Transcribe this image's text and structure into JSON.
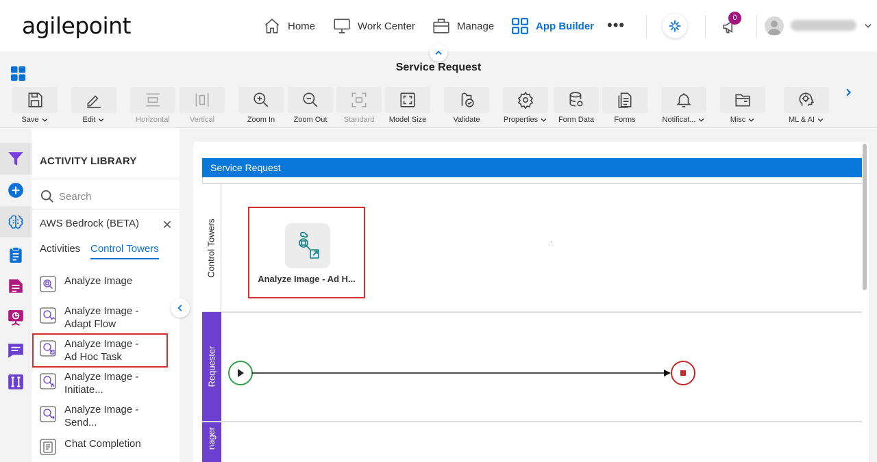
{
  "brand": {
    "logo_text": "agilepoint"
  },
  "nav": {
    "items": [
      {
        "label": "Home",
        "icon": "home-icon"
      },
      {
        "label": "Work Center",
        "icon": "monitor-icon"
      },
      {
        "label": "Manage",
        "icon": "briefcase-icon"
      },
      {
        "label": "App Builder",
        "icon": "grid-icon",
        "active": true
      }
    ],
    "more": "•••",
    "notification_count": "0"
  },
  "title_bar": {
    "title": "Service Request"
  },
  "toolbar": {
    "tools": [
      {
        "label": "Save",
        "icon": "save-icon",
        "dropdown": true
      },
      {
        "label": "Edit",
        "icon": "pencil-icon",
        "dropdown": true
      },
      {
        "label": "Horizontal",
        "icon": "horizontal-layout-icon",
        "disabled": true
      },
      {
        "label": "Vertical",
        "icon": "vertical-layout-icon",
        "disabled": true
      },
      {
        "label": "Zoom In",
        "icon": "zoom-in-icon"
      },
      {
        "label": "Zoom Out",
        "icon": "zoom-out-icon"
      },
      {
        "label": "Standard",
        "icon": "standard-size-icon",
        "disabled": true
      },
      {
        "label": "Model Size",
        "icon": "model-size-icon"
      },
      {
        "label": "Validate",
        "icon": "validate-icon"
      },
      {
        "label": "Properties",
        "icon": "gear-icon",
        "dropdown": true
      },
      {
        "label": "Form Data",
        "icon": "database-icon"
      },
      {
        "label": "Forms",
        "icon": "forms-icon"
      },
      {
        "label": "Notificat...",
        "icon": "bell-icon",
        "dropdown": true
      },
      {
        "label": "Misc",
        "icon": "folder-icon",
        "dropdown": true
      },
      {
        "label": "ML & AI",
        "icon": "ai-head-icon",
        "dropdown": true
      }
    ]
  },
  "library": {
    "title": "ACTIVITY LIBRARY",
    "search_placeholder": "Search",
    "section": "AWS Bedrock (BETA)",
    "tabs": {
      "activities": "Activities",
      "control_towers": "Control Towers"
    },
    "items": [
      {
        "lines": [
          "Analyze Image"
        ]
      },
      {
        "lines": [
          "Analyze Image -",
          "Adapt Flow"
        ]
      },
      {
        "lines": [
          "Analyze Image -",
          "Ad Hoc Task"
        ]
      },
      {
        "lines": [
          "Analyze Image -",
          "Initiate..."
        ]
      },
      {
        "lines": [
          "Analyze Image -",
          "Send..."
        ]
      },
      {
        "lines": [
          "Chat Completion"
        ]
      }
    ]
  },
  "canvas": {
    "pool_title": "Service Request",
    "lanes": [
      "Control Towers",
      "Requester",
      "nager"
    ],
    "task_label": "Analyze Image - Ad H..."
  },
  "colors": {
    "accent": "#0a6fd6",
    "pool_header": "#0a78d8",
    "lane": "#6b3fd0",
    "highlight": "#d32f2f",
    "start_event": "#2e9e4a",
    "end_event": "#c62828",
    "badge": "#a4167e"
  }
}
